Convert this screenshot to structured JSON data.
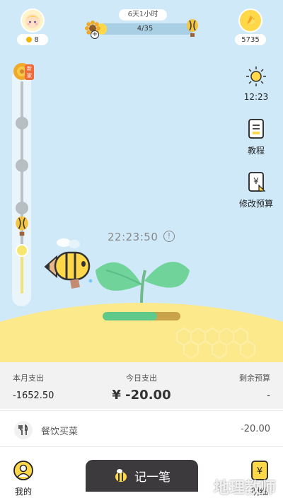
{
  "header": {
    "level_badge": "8",
    "progress_time": "6天1小时",
    "progress_count": "4/35",
    "progress_fraction": 0.11,
    "coins": "5735"
  },
  "track": {
    "new_tag": "新家"
  },
  "sidebar": {
    "weather_time": "12:23",
    "tutorial_label": "教程",
    "budget_label": "修改预算"
  },
  "scene": {
    "timer": "22:23:50",
    "info_symbol": "!",
    "grow_progress": 0.7
  },
  "stats": {
    "month_label": "本月支出",
    "month_value": "-1652.50",
    "today_label": "今日支出",
    "today_value": "¥ -20.00",
    "remain_label": "剩余预算",
    "remain_value": "-"
  },
  "entries": [
    {
      "category": "餐饮买菜",
      "amount": "-20.00",
      "icon": "fork-spoon-icon"
    }
  ],
  "bottom_nav": {
    "mine": "我的",
    "record": "记一笔",
    "detail": "明细",
    "watermark": "地理教师"
  },
  "colors": {
    "sky": "#cfe9f8",
    "hill": "#fbe98c",
    "accent": "#ffd84a",
    "leaf": "#6fd39a"
  }
}
